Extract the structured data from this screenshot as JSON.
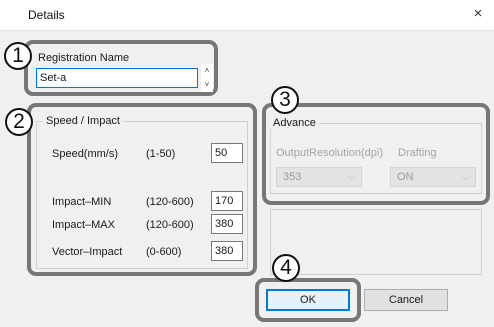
{
  "window": {
    "title": "Details",
    "close_glyph": "×"
  },
  "callouts": [
    "1",
    "2",
    "3",
    "4"
  ],
  "registration": {
    "label": "Registration Name",
    "value": "Set-a",
    "spin_up": "˄",
    "spin_down": "˅"
  },
  "speed_impact": {
    "legend": "Speed / Impact",
    "rows": [
      {
        "label": "Speed(mm/s)",
        "range": "(1-50)",
        "value": "50"
      },
      {
        "label": "Impact–MIN",
        "range": "(120-600)",
        "value": "170"
      },
      {
        "label": "Impact–MAX",
        "range": "(120-600)",
        "value": "380"
      },
      {
        "label": "Vector–Impact",
        "range": "(0-600)",
        "value": "380"
      }
    ]
  },
  "advance": {
    "legend": "Advance",
    "output_resolution": {
      "label": "OutputResolution(dpi)",
      "value": "353"
    },
    "drafting": {
      "label": "Drafting",
      "value": "ON"
    },
    "arrow": "⌵"
  },
  "buttons": {
    "ok": "OK",
    "cancel": "Cancel"
  }
}
